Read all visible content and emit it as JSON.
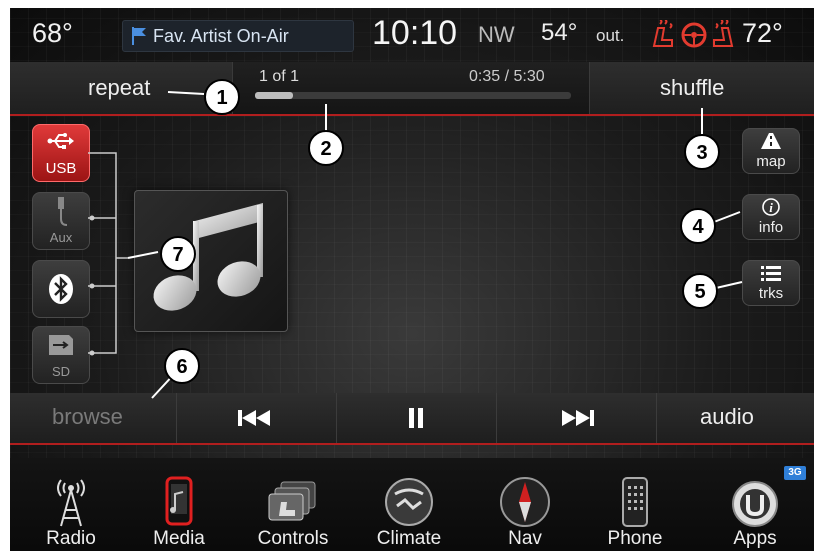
{
  "status": {
    "temp_left": "68°",
    "fav_artist": "Fav. Artist On-Air",
    "clock": "10:10",
    "direction": "NW",
    "outside_temp": "54°",
    "outside_label": "out.",
    "temp_right": "72°"
  },
  "now_playing": {
    "repeat": "repeat",
    "track_count": "1 of 1",
    "time": "0:35 / 5:30",
    "progress": 0.12,
    "shuffle": "shuffle"
  },
  "sources": [
    {
      "label": "USB",
      "icon": "usb-icon",
      "active": true
    },
    {
      "label": "Aux",
      "icon": "aux-icon",
      "active": false
    },
    {
      "label": "",
      "icon": "bluetooth-icon",
      "active": false
    },
    {
      "label": "SD",
      "icon": "sd-card-icon",
      "active": false
    }
  ],
  "right_buttons": {
    "map": "map",
    "info": "info",
    "trks": "trks"
  },
  "transport": {
    "browse": "browse",
    "audio": "audio"
  },
  "dock": [
    {
      "label": "Radio",
      "icon": "radio-tower-icon"
    },
    {
      "label": "Media",
      "icon": "media-icon"
    },
    {
      "label": "Controls",
      "icon": "controls-icon"
    },
    {
      "label": "Climate",
      "icon": "climate-icon"
    },
    {
      "label": "Nav",
      "icon": "compass-icon"
    },
    {
      "label": "Phone",
      "icon": "phone-icon"
    },
    {
      "label": "Apps",
      "icon": "apps-icon",
      "badge": "3G"
    }
  ],
  "callouts": [
    "1",
    "2",
    "3",
    "4",
    "5",
    "6",
    "7"
  ],
  "colors": {
    "accent_red": "#b11e1e",
    "usb_active": "#d42c2c",
    "fav_flag": "#4a8fe0"
  }
}
